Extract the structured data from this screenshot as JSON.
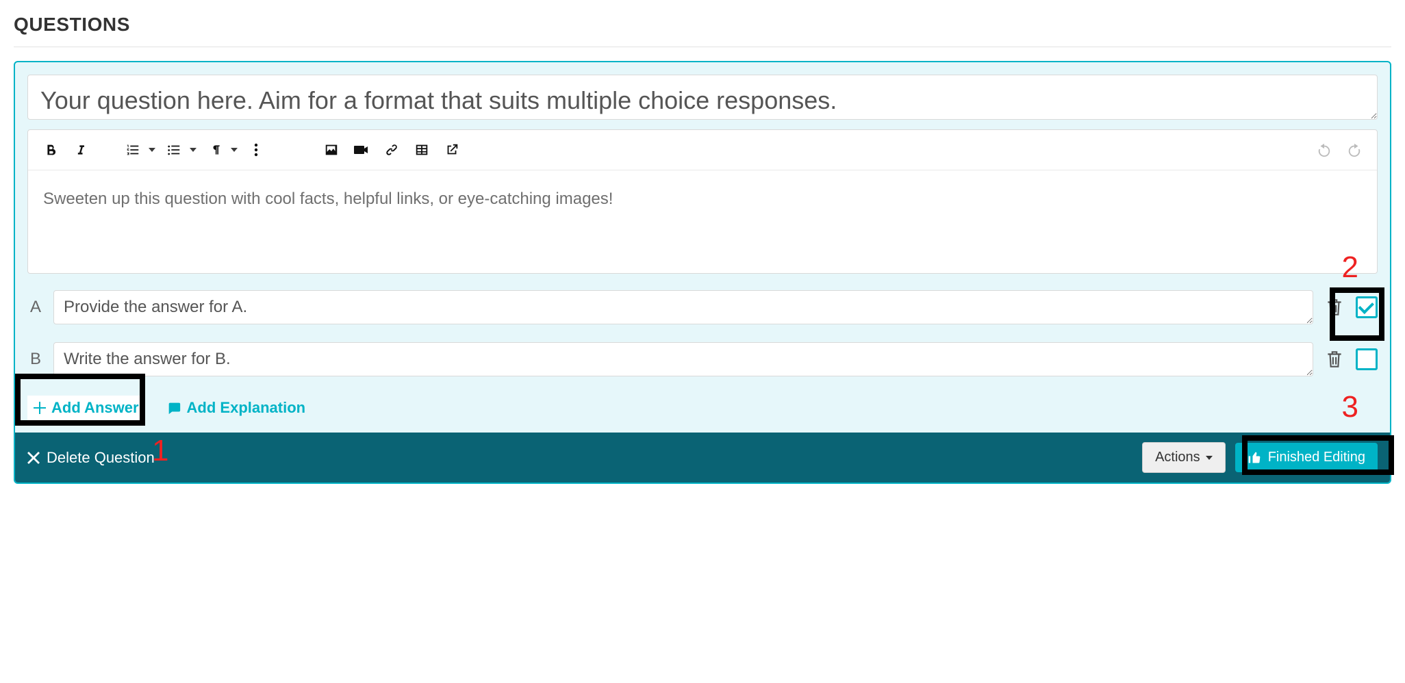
{
  "page": {
    "title": "QUESTIONS"
  },
  "question": {
    "placeholder": "Your question here. Aim for a format that suits multiple choice responses.",
    "description_placeholder": "Sweeten up this question with cool facts, helpful links, or eye-catching images!"
  },
  "answers": [
    {
      "letter": "A",
      "placeholder": "Provide the answer for A.",
      "correct": true
    },
    {
      "letter": "B",
      "placeholder": "Write the answer for B.",
      "correct": false
    }
  ],
  "buttons": {
    "add_answer": "Add Answer",
    "add_explanation": "Add Explanation",
    "delete_question": "Delete Question",
    "actions": "Actions",
    "finished_editing": "Finished Editing"
  },
  "annotations": {
    "n1": "1",
    "n2": "2",
    "n3": "3"
  }
}
